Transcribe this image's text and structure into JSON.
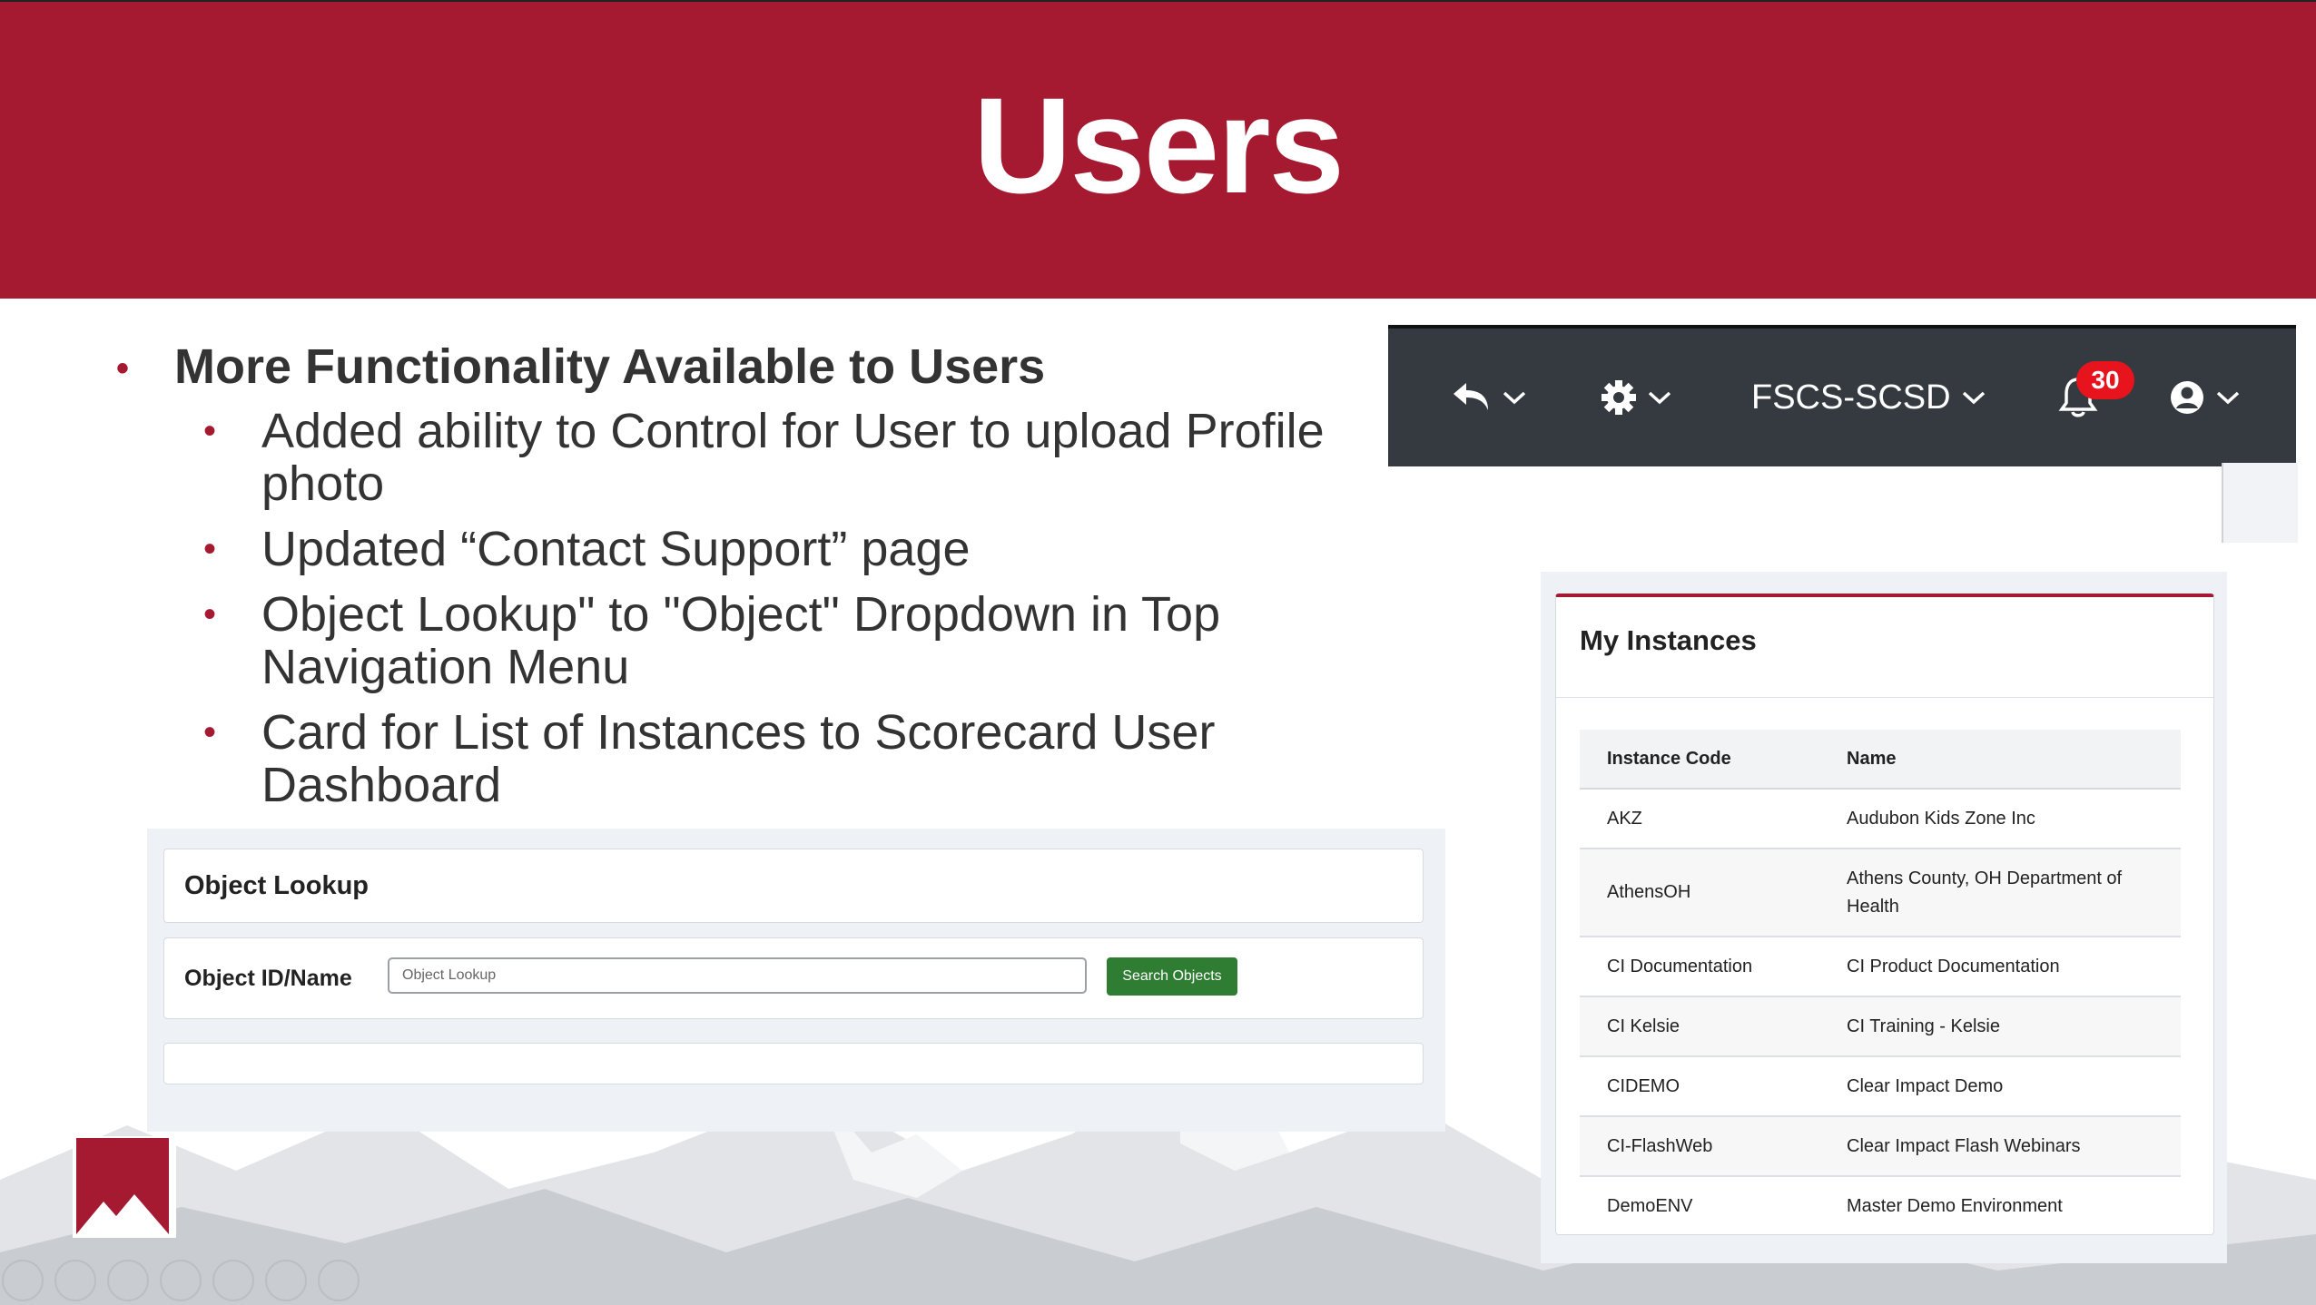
{
  "slide": {
    "title": "Users"
  },
  "bullets": {
    "main": "More Functionality Available to Users",
    "items": [
      "Added ability to Control for User to upload Profile photo",
      "Updated “Contact Support” page",
      "Object Lookup\" to \"Object\" Dropdown in Top Navigation Menu",
      "Card for List of Instances to Scorecard User Dashboard"
    ]
  },
  "object_lookup": {
    "title": "Object Lookup",
    "field_label": "Object ID/Name",
    "input_placeholder": "Object Lookup",
    "button_label": "Search Objects"
  },
  "navbar": {
    "environment": "FSCS-SCSD",
    "notification_count": "30",
    "icons": [
      "undo-icon",
      "gear-icon",
      "bell-icon",
      "user-circle-icon",
      "chevron-down-icon"
    ]
  },
  "instances": {
    "title": "My Instances",
    "columns": [
      "Instance Code",
      "Name"
    ],
    "rows": [
      [
        "AKZ",
        "Audubon Kids Zone Inc"
      ],
      [
        "AthensOH",
        "Athens County, OH Department of Health"
      ],
      [
        "CI Documentation",
        "CI Product Documentation"
      ],
      [
        "CI Kelsie",
        "CI Training - Kelsie"
      ],
      [
        "CIDEMO",
        "Clear Impact Demo"
      ],
      [
        "CI-FlashWeb",
        "Clear Impact Flash Webinars"
      ],
      [
        "DemoENV",
        "Master Demo Environment"
      ]
    ]
  },
  "colors": {
    "brand": "#a51a30",
    "navbar": "#343a40",
    "button": "#2e7d32",
    "badge": "#e8141d"
  }
}
